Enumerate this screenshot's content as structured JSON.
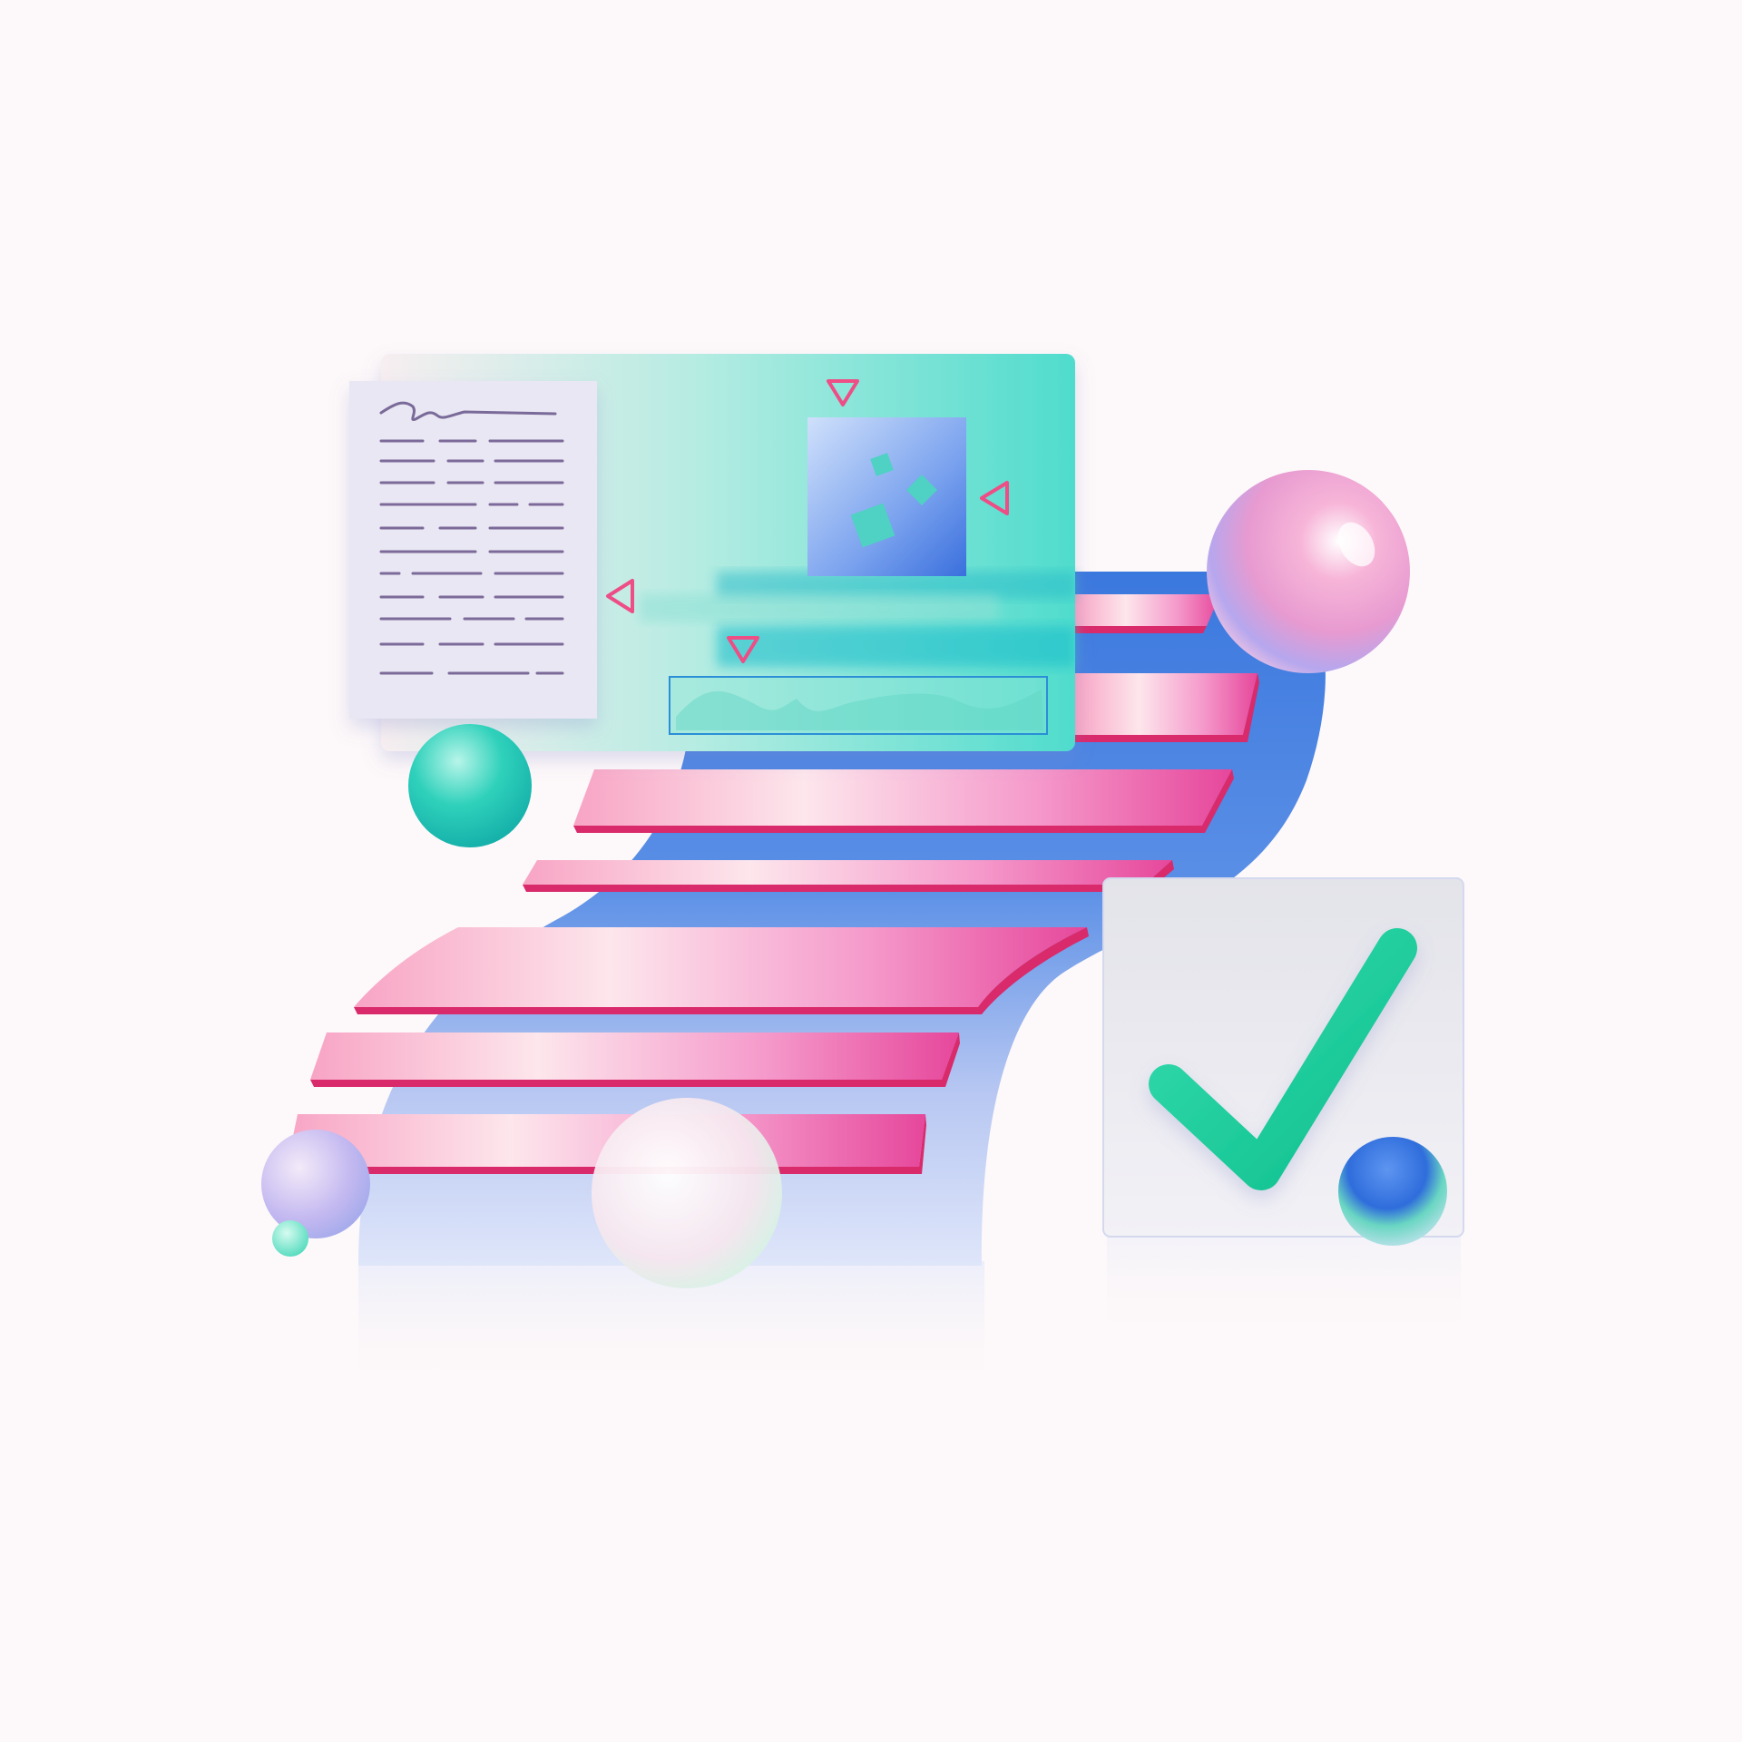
{
  "illustration": {
    "background_color": "#fdf8f9",
    "palette": {
      "pink_light": "#fde3ea",
      "pink": "#f78cc0",
      "pink_deep": "#e8458f",
      "pink_edge": "#d92a6b",
      "blue": "#3d7fe0",
      "blue_light": "#c9d7f5",
      "teal": "#2fd2c2",
      "teal_deep": "#12c4b0",
      "green_check": "#14c28f",
      "document_paper": "#e9e7f3",
      "document_lines": "#7c6a99",
      "card_gray": "#e4e4ec"
    },
    "icons": [
      "document-icon",
      "signature-icon",
      "image-frame-icon",
      "play-triangle-icon",
      "waveform-icon",
      "checkmark-icon",
      "sphere-icon"
    ]
  }
}
